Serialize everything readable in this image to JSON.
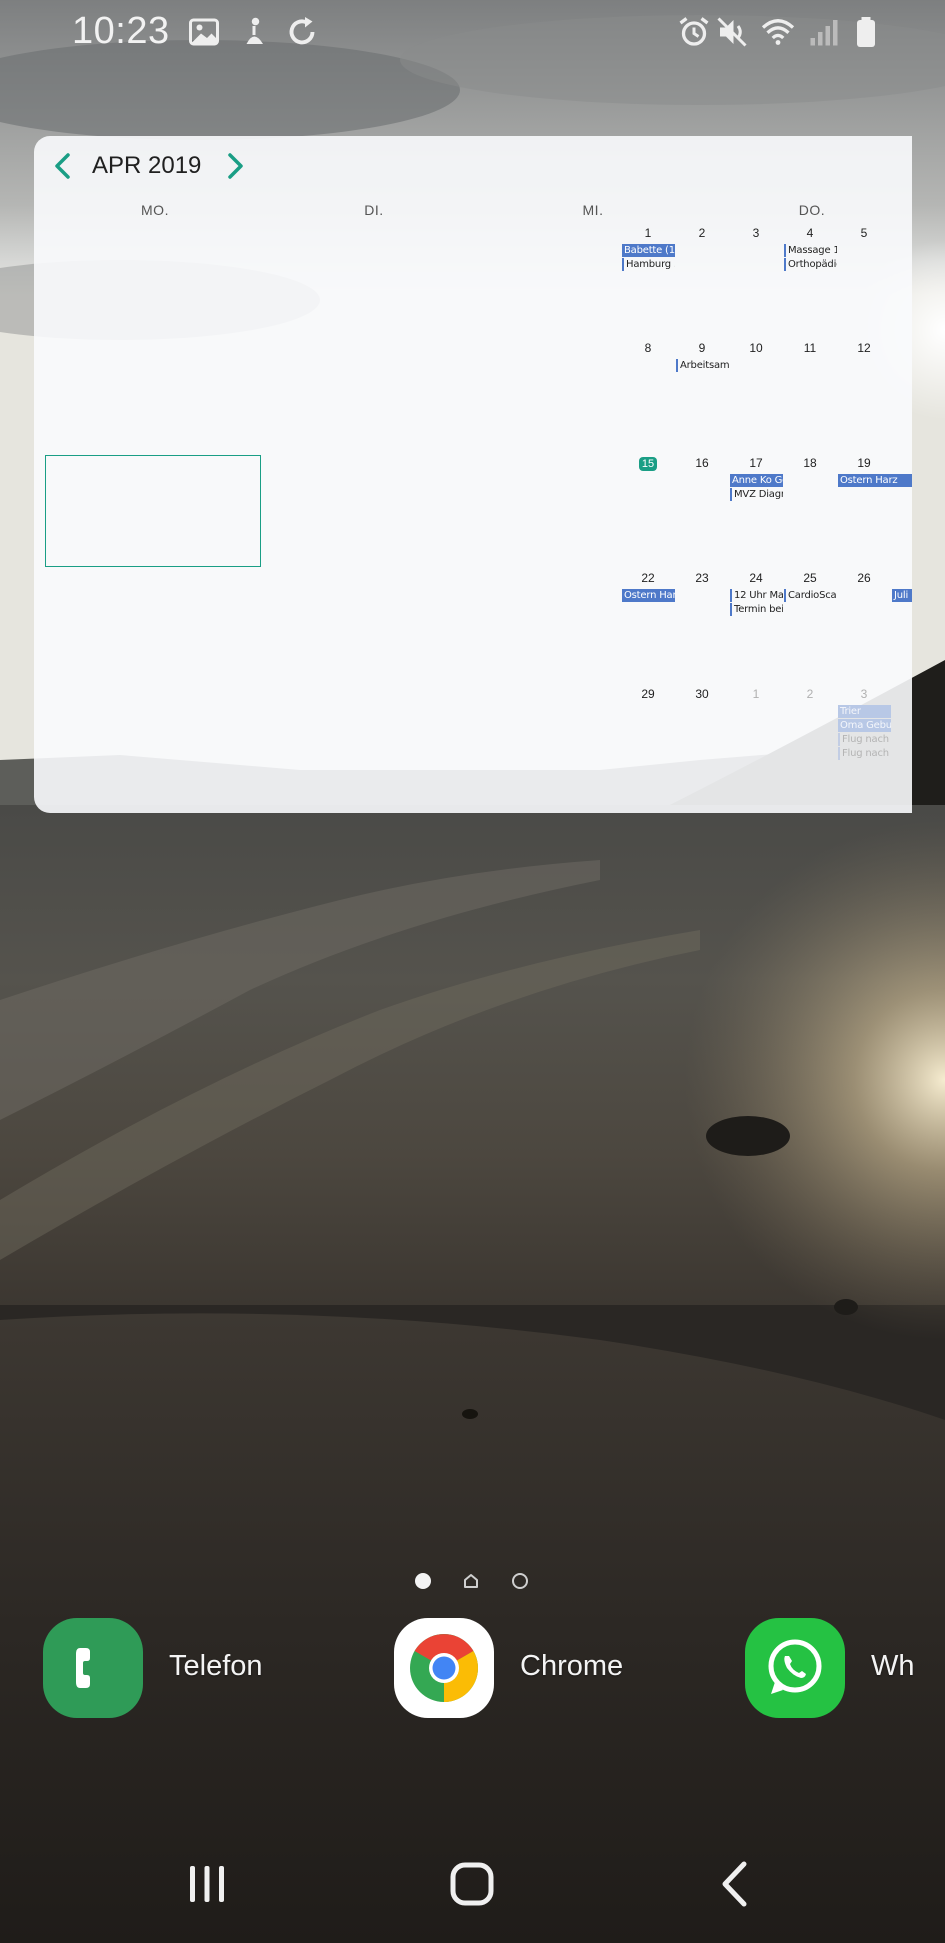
{
  "status_bar": {
    "time": "10:23",
    "left_icons": [
      "image-icon",
      "notification-icon",
      "sync-icon"
    ],
    "right_icons": [
      "alarm-icon",
      "mute-icon",
      "wifi-icon",
      "signal-icon",
      "battery-icon"
    ]
  },
  "calendar_widget": {
    "month_title": "APR 2019",
    "accent_color": "#1a9e85",
    "event_color": "#4e79c9",
    "weekdays": [
      "MO.",
      "DI.",
      "MI.",
      "DO."
    ],
    "weeks": [
      {
        "days": [
          {
            "num": "1",
            "events": [
              {
                "text": "Babette (1!",
                "style": "fill"
              },
              {
                "text": "Hamburg .",
                "style": "line"
              }
            ]
          },
          {
            "num": "2",
            "events": []
          },
          {
            "num": "3",
            "events": []
          },
          {
            "num": "4",
            "events": [
              {
                "text": "Massage 1",
                "style": "line"
              },
              {
                "text": "Orthopädie",
                "style": "line"
              }
            ]
          },
          {
            "num": "5",
            "events": []
          }
        ]
      },
      {
        "days": [
          {
            "num": "8",
            "events": []
          },
          {
            "num": "9",
            "events": [
              {
                "text": "Arbeitsamt",
                "style": "line"
              }
            ]
          },
          {
            "num": "10",
            "events": []
          },
          {
            "num": "11",
            "events": []
          },
          {
            "num": "12",
            "events": []
          }
        ]
      },
      {
        "days": [
          {
            "num": "15",
            "today": true,
            "events": []
          },
          {
            "num": "16",
            "events": []
          },
          {
            "num": "17",
            "events": [
              {
                "text": "Anne Ko Ge",
                "style": "fill"
              },
              {
                "text": "MVZ Diagr",
                "style": "line"
              }
            ]
          },
          {
            "num": "18",
            "events": []
          },
          {
            "num": "19",
            "events": [
              {
                "text": "Ostern Harz",
                "style": "fill",
                "span": true
              }
            ]
          }
        ]
      },
      {
        "days": [
          {
            "num": "22",
            "events": [
              {
                "text": "Ostern Har",
                "style": "fill"
              }
            ]
          },
          {
            "num": "23",
            "events": []
          },
          {
            "num": "24",
            "events": [
              {
                "text": "12 Uhr Ma:",
                "style": "line"
              },
              {
                "text": "Termin bei",
                "style": "line"
              }
            ]
          },
          {
            "num": "25",
            "events": [
              {
                "text": "CardioScar",
                "style": "line"
              }
            ]
          },
          {
            "num": "26",
            "events": [
              {
                "text": "Juli",
                "style": "fill",
                "offset": true
              }
            ]
          }
        ]
      },
      {
        "days": [
          {
            "num": "29",
            "events": []
          },
          {
            "num": "30",
            "events": []
          },
          {
            "num": "1",
            "muted": true,
            "events": []
          },
          {
            "num": "2",
            "muted": true,
            "events": []
          },
          {
            "num": "3",
            "muted": true,
            "events": [
              {
                "text": "Trier",
                "style": "fill",
                "faded": true
              },
              {
                "text": "Oma Gebui",
                "style": "fill",
                "faded": true
              },
              {
                "text": "Flug nach I",
                "style": "line",
                "faded": true
              },
              {
                "text": "Flug nach I",
                "style": "line",
                "faded": true
              }
            ]
          }
        ]
      }
    ]
  },
  "page_indicator": {
    "pages": [
      "dot",
      "home",
      "ring"
    ],
    "active_index": 0
  },
  "dock": {
    "apps": [
      {
        "label": "Telefon",
        "icon": "phone-icon",
        "color": "#2f9b57"
      },
      {
        "label": "Chrome",
        "icon": "chrome-icon",
        "color": "#ffffff"
      },
      {
        "label": "Wh",
        "icon": "whatsapp-icon",
        "color": "#25c243"
      }
    ]
  },
  "navigation_bar": {
    "buttons": [
      "recent-apps-icon",
      "home-icon",
      "back-icon"
    ]
  }
}
